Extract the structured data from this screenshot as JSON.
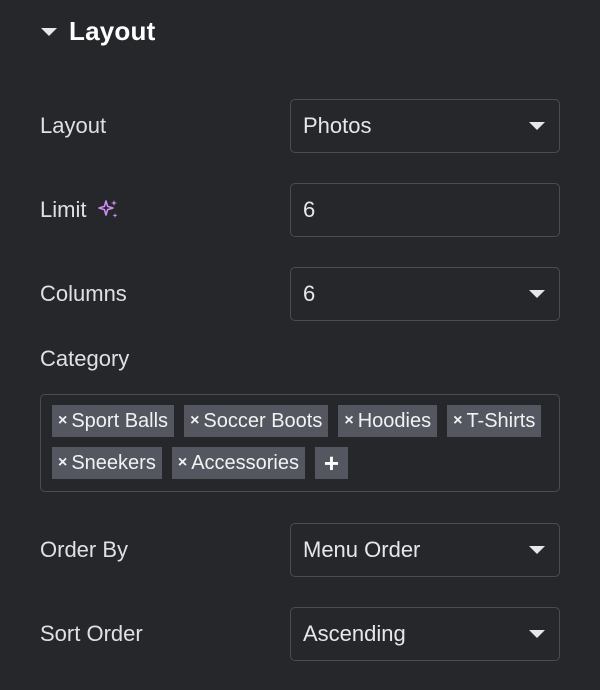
{
  "section": {
    "title": "Layout"
  },
  "layout": {
    "label": "Layout",
    "value": "Photos"
  },
  "limit": {
    "label": "Limit",
    "value": "6"
  },
  "columns": {
    "label": "Columns",
    "value": "6"
  },
  "category": {
    "label": "Category",
    "tags": [
      "Sport Balls",
      "Soccer Boots",
      "Hoodies",
      "T-Shirts",
      "Sneekers",
      "Accessories"
    ],
    "remove_glyph": "×",
    "add_glyph": "+"
  },
  "order_by": {
    "label": "Order By",
    "value": "Menu Order"
  },
  "sort_order": {
    "label": "Sort Order",
    "value": "Ascending"
  },
  "colors": {
    "background": "#26272b",
    "border": "#4a4c52",
    "tag_bg": "#54575f",
    "ai_accent": "#d08cf0"
  },
  "icons": {
    "section_toggle": "caret-down-icon",
    "ai": "sparkle-icon",
    "select": "chevron-down-icon",
    "remove": "close-icon",
    "add": "plus-icon"
  }
}
